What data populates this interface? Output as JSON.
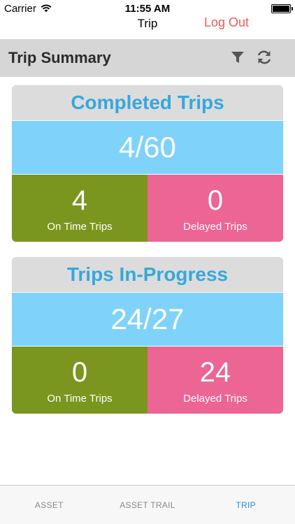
{
  "status_bar": {
    "carrier": "Carrier",
    "time": "11:55 AM",
    "wifi_icon": "wifi-icon",
    "battery_icon": "battery-icon"
  },
  "nav": {
    "title": "Trip",
    "logout_label": "Log Out"
  },
  "section": {
    "title": "Trip Summary",
    "filter_icon": "filter-icon",
    "refresh_icon": "refresh-icon"
  },
  "completed": {
    "title": "Completed Trips",
    "total": "4/60",
    "on_time_value": "4",
    "on_time_label": "On Time Trips",
    "delayed_value": "0",
    "delayed_label": "Delayed Trips"
  },
  "in_progress": {
    "title": "Trips In-Progress",
    "total": "24/27",
    "on_time_value": "0",
    "on_time_label": "On Time Trips",
    "delayed_value": "24",
    "delayed_label": "Delayed Trips"
  },
  "tabs": [
    {
      "label": "ASSET",
      "active": false
    },
    {
      "label": "ASSET TRAIL",
      "active": false
    },
    {
      "label": "TRIP",
      "active": true
    }
  ],
  "colors": {
    "accent_blue": "#34a8dd",
    "total_bg": "#7fd3fb",
    "on_time_green": "#7a961e",
    "delayed_pink": "#ec6595",
    "logout_red": "#ee5a5a",
    "active_tab": "#1f8ed8"
  }
}
